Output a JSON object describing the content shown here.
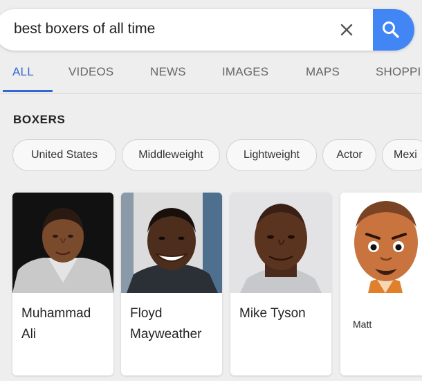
{
  "search": {
    "query": "best boxers of all time"
  },
  "icons": {
    "clear": "close-icon",
    "search": "search-icon"
  },
  "colors": {
    "accent": "#3367d6",
    "search_button": "#4285f4"
  },
  "tabs": [
    {
      "label": "ALL",
      "active": true
    },
    {
      "label": "VIDEOS"
    },
    {
      "label": "NEWS"
    },
    {
      "label": "IMAGES"
    },
    {
      "label": "MAPS"
    },
    {
      "label": "SHOPPI"
    }
  ],
  "section": {
    "label": "BOXERS"
  },
  "chips": [
    "United States",
    "Middleweight",
    "Lightweight",
    "Actor",
    "Mexi"
  ],
  "cards": [
    {
      "name_line1": "Muhammad",
      "name_line2": "Ali"
    },
    {
      "name_line1": "Floyd",
      "name_line2": "Mayweather"
    },
    {
      "name_line1": "Mike Tyson"
    },
    {
      "name_line1": "Matt"
    }
  ]
}
